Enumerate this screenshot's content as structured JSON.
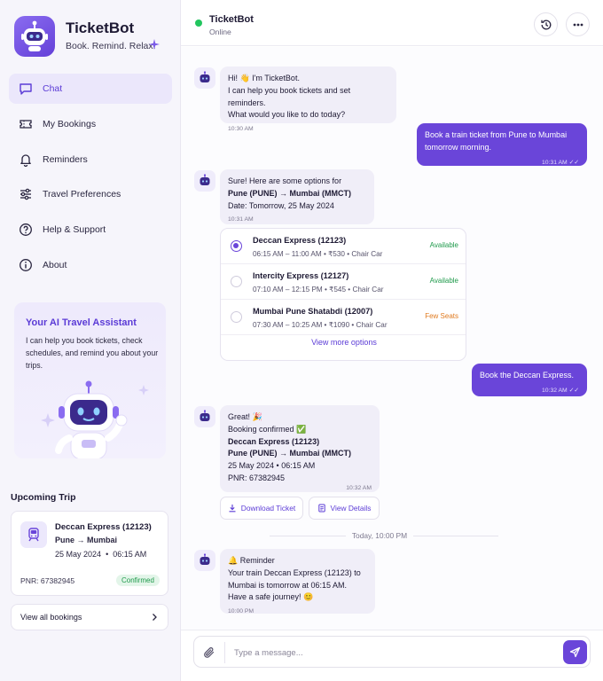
{
  "brand": {
    "name": "TicketBot",
    "tagline": "Book. Remind. Relax."
  },
  "nav": {
    "items": [
      {
        "label": "Chat",
        "icon": "chat-icon",
        "active": true
      },
      {
        "label": "My Bookings",
        "icon": "ticket-icon"
      },
      {
        "label": "Reminders",
        "icon": "bell-icon"
      },
      {
        "label": "Travel Preferences",
        "icon": "sliders-icon"
      },
      {
        "label": "Help & Support",
        "icon": "help-icon"
      },
      {
        "label": "About",
        "icon": "info-icon"
      }
    ]
  },
  "promo": {
    "title": "Your AI Travel Assistant",
    "text": "I can help you book tickets, check schedules, and remind you about your trips."
  },
  "upcoming": {
    "title": "Upcoming Trip",
    "train": "Deccan Express (12123)",
    "route": "Pune → Mumbai",
    "date": "25 May 2024",
    "sep": "•",
    "time": "06:15 AM",
    "pnr": "PNR: 67382945",
    "status": "Confirmed",
    "view_all": "View all bookings"
  },
  "header": {
    "title": "TicketBot",
    "status": "Online",
    "status_color": "#22c55e"
  },
  "messages": {
    "m1": {
      "line1": "Hi! 👋 I'm TicketBot.",
      "line2": "I can help you book tickets and set reminders.",
      "line3": "What would you like to do today?",
      "time": "10:30 AM"
    },
    "m2": {
      "line1": "Book a train ticket from Pune to Mumbai",
      "line2": "tomorrow morning.",
      "time": "10:31 AM ✓✓"
    },
    "m3": {
      "line1": "Sure! Here are some options for",
      "line2": "Pune (PUNE) → Mumbai (MMCT)",
      "line3": "Date: Tomorrow, 25 May 2024",
      "time": "10:31 AM"
    },
    "m4": {
      "line1": "Book the Deccan Express.",
      "time": "10:32 AM ✓✓"
    },
    "m5": {
      "line1": "Great! 🎉",
      "line2": "Booking confirmed ✅",
      "line3": "Deccan Express (12123)",
      "line4": "Pune (PUNE) → Mumbai (MMCT)",
      "line5": "25 May 2024  •  06:15 AM",
      "line6": "PNR: 67382945",
      "time": "10:32 AM"
    },
    "m6": {
      "line1": "🔔 Reminder",
      "line2": "Your train Deccan Express (12123) to",
      "line3": "Mumbai is tomorrow at 06:15 AM.",
      "line4": "Have a safe journey! 😊",
      "time": "10:00 PM"
    }
  },
  "train_options": [
    {
      "name": "Deccan Express (12123)",
      "meta": "06:15 AM – 11:00 AM  •  ₹530  •  Chair Car",
      "status": "Available",
      "status_color": "#1f9a4b",
      "selected": true
    },
    {
      "name": "Intercity Express (12127)",
      "meta": "07:10 AM – 12:15 PM  •  ₹545  •  Chair Car",
      "status": "Available",
      "status_color": "#1f9a4b",
      "selected": false
    },
    {
      "name": "Mumbai Pune Shatabdi (12007)",
      "meta": "07:30 AM – 10:25 AM  •  ₹1090  •  Chair Car",
      "status": "Few Seats",
      "status_color": "#e07a1f",
      "selected": false
    }
  ],
  "view_more": "View more options",
  "actions": {
    "download": "Download Ticket",
    "details": "View Details"
  },
  "divider": "Today, 10:00 PM",
  "composer": {
    "placeholder": "Type a message..."
  },
  "colors": {
    "accent": "#6a45d9",
    "accent_light": "#ebe7fb",
    "bot_bubble": "#f0eef8"
  }
}
